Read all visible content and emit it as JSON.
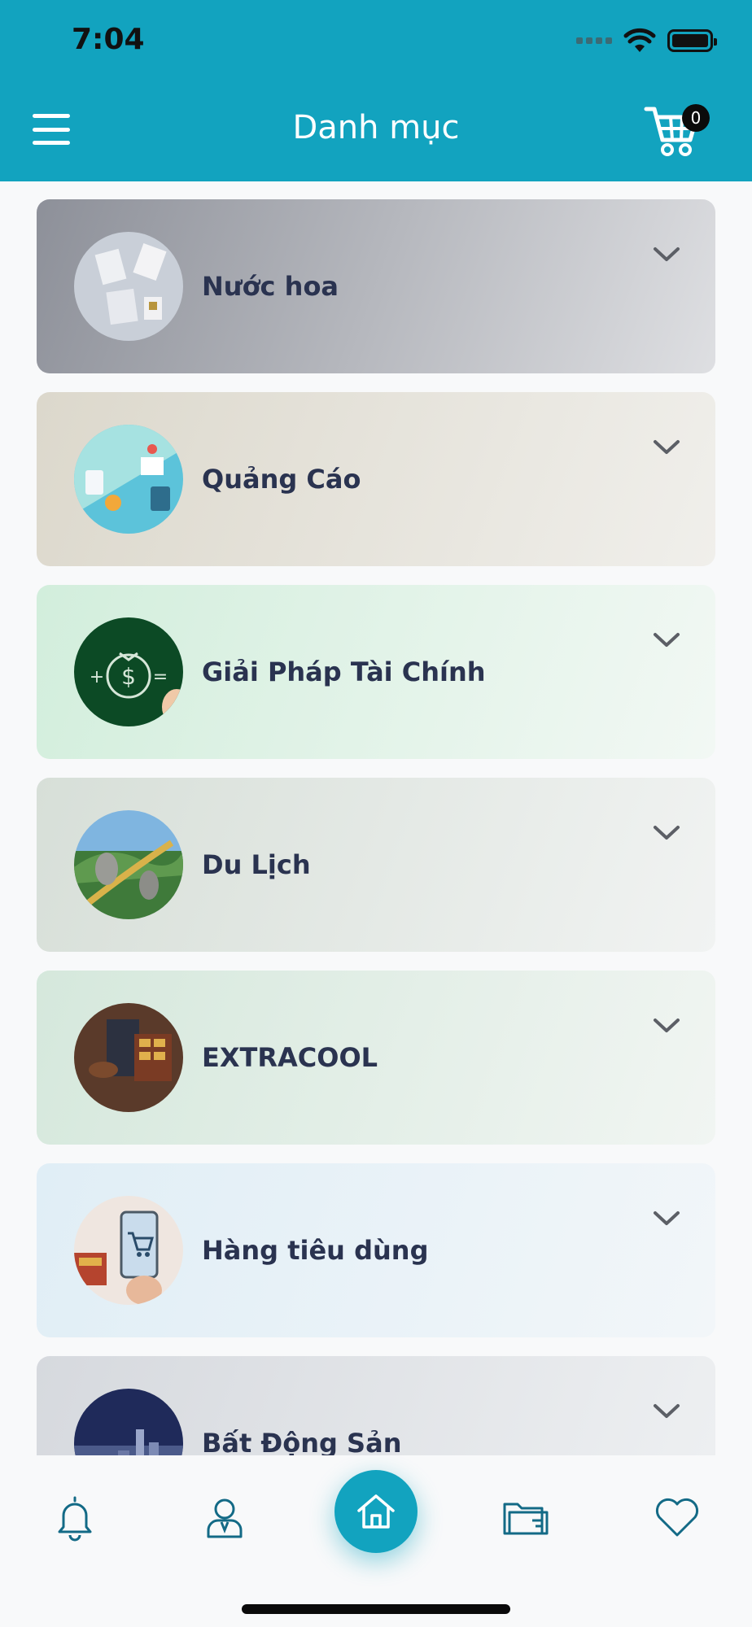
{
  "status_bar": {
    "time": "7:04"
  },
  "header": {
    "title": "Danh mục",
    "cart_count": "0"
  },
  "categories": [
    {
      "label": "Nước hoa",
      "thumb_icon": "perfume-boxes-image",
      "bg_from": "#8d9099",
      "bg_to": "#dedfe2"
    },
    {
      "label": "Quảng Cáo",
      "thumb_icon": "advertising-image",
      "bg_from": "#dcd8cc",
      "bg_to": "#f0efeb"
    },
    {
      "label": "Giải Pháp Tài Chính",
      "thumb_icon": "money-bag-image",
      "bg_from": "#d2eedc",
      "bg_to": "#f2f8f4"
    },
    {
      "label": "Du Lịch",
      "thumb_icon": "golden-bridge-image",
      "bg_from": "#d7dfd8",
      "bg_to": "#f1f3f2"
    },
    {
      "label": "EXTRACOOL",
      "thumb_icon": "extracool-product-image",
      "bg_from": "#d5e8dc",
      "bg_to": "#f1f5f2"
    },
    {
      "label": "Hàng tiêu dùng",
      "thumb_icon": "shopping-cart-phone-image",
      "bg_from": "#e0eef6",
      "bg_to": "#f2f6f9"
    },
    {
      "label": "Bất Động Sản",
      "thumb_icon": "real-estate-image",
      "bg_from": "#d6d9de",
      "bg_to": "#eef0f2"
    }
  ],
  "bottom_nav": {
    "items": [
      "bell-icon",
      "user-profile-icon",
      "home-icon",
      "folder-icon",
      "heart-icon"
    ],
    "active": "home-icon"
  },
  "colors": {
    "primary": "#12a3bf",
    "label": "#2a3350"
  }
}
